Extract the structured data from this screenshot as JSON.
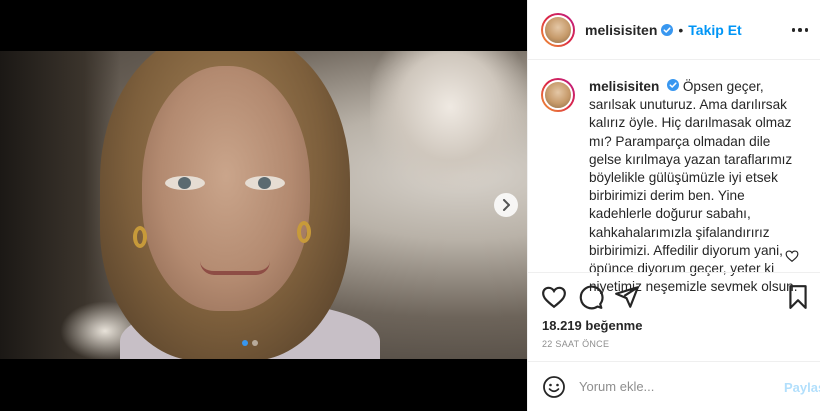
{
  "post": {
    "username": "melisisiten",
    "verified": true,
    "follow_label": "Takip Et",
    "separator": "•",
    "caption": "Öpsen geçer, sarılsak unuturuz. Ama darılırsak kalırız öyle. Hiç darılmasak olmaz mı? Paramparça olmadan dile gelse kırılmaya yazan taraflarımız böylelikle gülüşümüzle iyi etsek birbirimizi derim ben. Yine kadehlerle doğurur sabahı, kahkahalarımızla şifalandırırız birbirimizi. Affedilir diyorum yani, öpünce diyorum geçer, yeter ki niyetimiz neşemizle sevmek olsun.",
    "likes": "18.219 beğenme",
    "time": "22 SAAT ÖNCE"
  },
  "carousel": {
    "total_slides": 2,
    "current_slide": 1
  },
  "comment": {
    "placeholder": "Yorum ekle...",
    "share_label": "Paylaş"
  },
  "colors": {
    "follow": "#0095f6",
    "verified": "#3897f0",
    "share_disabled": "#b2dffc",
    "carousel_active_dot": "#3897f0"
  },
  "icons": {
    "next": "chevron-right-icon",
    "more": "more-horizontal-icon",
    "like": "heart-icon",
    "comment": "comment-icon",
    "share": "send-icon",
    "save": "bookmark-icon",
    "emoji": "emoji-icon",
    "verified": "verified-badge-icon"
  }
}
